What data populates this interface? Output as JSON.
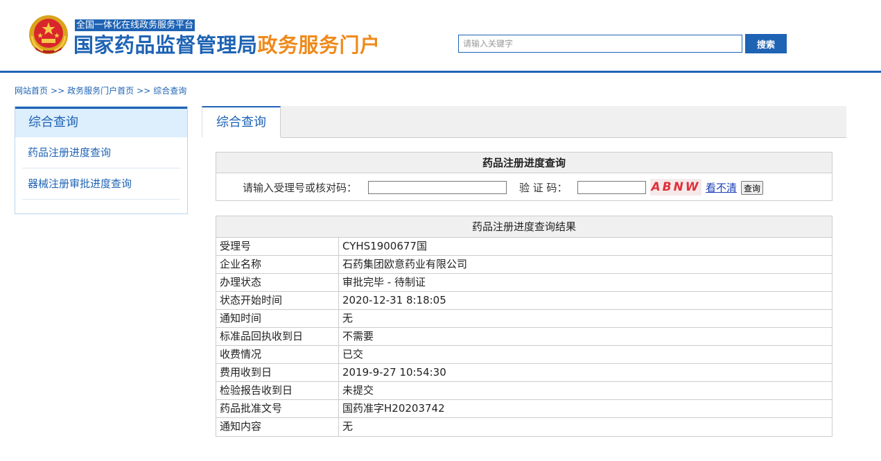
{
  "header": {
    "subtitle": "全国一体化在线政务服务平台",
    "title_blue": "国家药品监督管理局",
    "title_orange": "政务服务门户",
    "search_placeholder": "请输入关键字",
    "search_button": "搜索"
  },
  "breadcrumb": {
    "items": [
      "网站首页",
      "政务服务门户首页",
      "综合查询"
    ],
    "separator": ">>"
  },
  "sidebar": {
    "title": "综合查询",
    "items": [
      {
        "label": "药品注册进度查询"
      },
      {
        "label": "器械注册审批进度查询"
      }
    ]
  },
  "main": {
    "tab_label": "综合查询",
    "query": {
      "title": "药品注册进度查询",
      "number_label": "请输入受理号或核对码：",
      "captcha_label": "验 证 码：",
      "captcha_text": "ABNW",
      "refresh_link": "看不清",
      "submit_button": "查询"
    },
    "result": {
      "title": "药品注册进度查询结果",
      "rows": [
        {
          "key": "受理号",
          "value": "CYHS1900677国"
        },
        {
          "key": "企业名称",
          "value": "石药集团欧意药业有限公司"
        },
        {
          "key": "办理状态",
          "value": "审批完毕 - 待制证"
        },
        {
          "key": "状态开始时间",
          "value": "2020-12-31 8:18:05"
        },
        {
          "key": "通知时间",
          "value": "无"
        },
        {
          "key": "标准品回执收到日",
          "value": "不需要"
        },
        {
          "key": "收费情况",
          "value": "已交"
        },
        {
          "key": "费用收到日",
          "value": "2019-9-27 10:54:30"
        },
        {
          "key": "检验报告收到日",
          "value": "未提交"
        },
        {
          "key": "药品批准文号",
          "value": "国药准字H20203742"
        },
        {
          "key": "通知内容",
          "value": "无"
        }
      ]
    }
  },
  "colors": {
    "primary_blue": "#1e63b4",
    "accent_orange": "#ef8a1c",
    "captcha_red": "#e0303a"
  }
}
